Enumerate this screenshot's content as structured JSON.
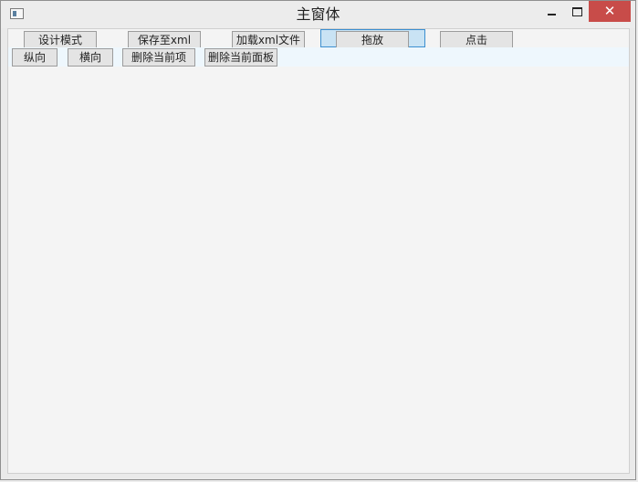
{
  "window": {
    "title": "主窗体",
    "close_glyph": "✕"
  },
  "toolbar": {
    "design_mode": "设计模式",
    "save_xml": "保存至xml",
    "load_xml": "加载xml文件",
    "drag_drop": "拖放",
    "click": "点击"
  },
  "layout_buttons": {
    "vertical": "纵向",
    "horizontal": "横向",
    "delete_item": "删除当前项",
    "delete_panel": "删除当前面板"
  },
  "icons": [
    "app-icon",
    "minimize-icon",
    "maximize-icon",
    "close-icon"
  ],
  "colors": {
    "close_button": "#c84c49",
    "drag_highlight": "#c9e3f4",
    "drag_border": "#3c8fd0",
    "strip": "#eef7fd"
  }
}
